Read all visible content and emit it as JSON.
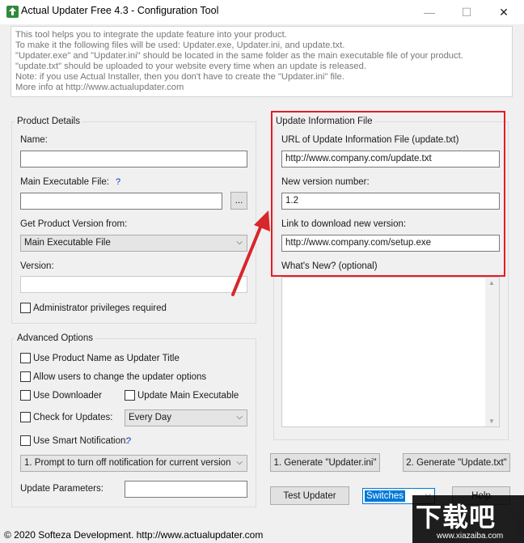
{
  "window": {
    "title": "Actual Updater Free 4.3 - Configuration Tool",
    "minimize_glyph": "—",
    "maximize_glyph": "☐",
    "close_glyph": "✕"
  },
  "intro": {
    "lines": [
      "This tool helps you to integrate the update feature into your product.",
      "To make it the following files will be used: Updater.exe, Updater.ini, and update.txt.",
      "\"Updater.exe\" and \"Updater.ini\" should be located in the same folder as the main executable file of your product.",
      "\"update.txt\" should be uploaded to your website every time when an update is released.",
      "Note: if you use Actual Installer, then you don't have to create the \"Updater.ini\" file.",
      "More info at http://www.actualupdater.com"
    ]
  },
  "product_details": {
    "title": "Product Details",
    "name_label": "Name:",
    "name_value": "",
    "main_exe_label": "Main Executable File:",
    "help_mark": "?",
    "main_exe_value": "",
    "browse_label": "...",
    "get_version_label": "Get Product Version from:",
    "get_version_selected": "Main Executable File",
    "version_label": "Version:",
    "version_value": "",
    "admin_label": "Administrator privileges required"
  },
  "advanced_options": {
    "title": "Advanced Options",
    "use_product_name": "Use Product Name as Updater Title",
    "allow_change": "Allow users to change the updater options",
    "use_downloader": "Use Downloader",
    "update_main_exe": "Update Main Executable",
    "check_updates": "Check for Updates:",
    "check_interval": "Every Day",
    "smart_notification": "Use Smart Notification:",
    "smart_help": "?",
    "prompt_option": "1. Prompt to turn off notification for current version",
    "update_params_label": "Update Parameters:",
    "update_params_value": ""
  },
  "update_info": {
    "title": "Update Information File",
    "url_label": "URL of Update Information File (update.txt)",
    "url_value": "http://www.company.com/update.txt",
    "new_version_label": "New version number:",
    "new_version_value": "1.2",
    "download_label": "Link to download new version:",
    "download_value": "http://www.company.com/setup.exe",
    "whats_new_label": "What's New? (optional)",
    "whats_new_value": ""
  },
  "buttons": {
    "generate_ini": "1. Generate \"Updater.ini\"",
    "generate_txt": "2. Generate \"Update.txt\"",
    "test_updater": "Test Updater",
    "switches": "Switches",
    "help": "Help"
  },
  "status": {
    "text": "© 2020 Softeza Development.  http://www.actualupdater.com"
  },
  "watermark": {
    "text": "下载吧",
    "url": "www.xiazaiba.com"
  },
  "colors": {
    "highlight_box": "#e51c23",
    "arrow": "#d8262c",
    "link_blue": "#0033cc",
    "selection_blue": "#0078d7"
  }
}
